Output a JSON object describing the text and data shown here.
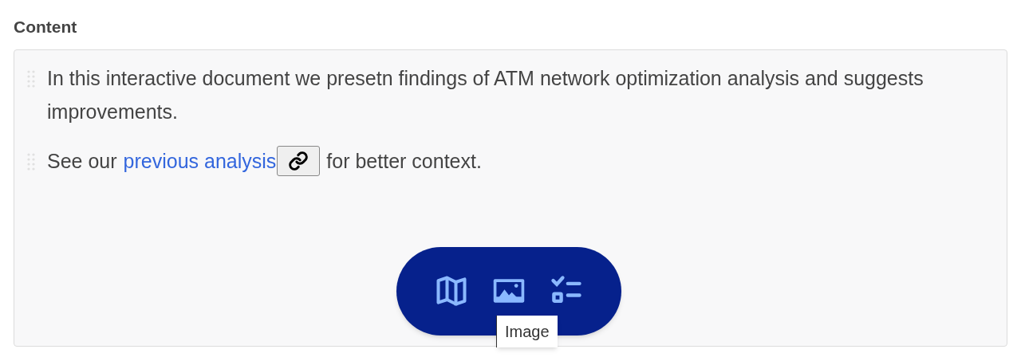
{
  "section_title": "Content",
  "paragraphs": [
    {
      "kind": "text",
      "text": "In this interactive document we presetn findings of ATM network optimization analysis and suggests improvements."
    },
    {
      "kind": "link",
      "before": "See our",
      "link": "previous analysis",
      "after": "for better context."
    }
  ],
  "toolbar": {
    "buttons": [
      {
        "kind": "map"
      },
      {
        "kind": "image"
      },
      {
        "kind": "checklist"
      }
    ],
    "tooltip": "Image"
  }
}
